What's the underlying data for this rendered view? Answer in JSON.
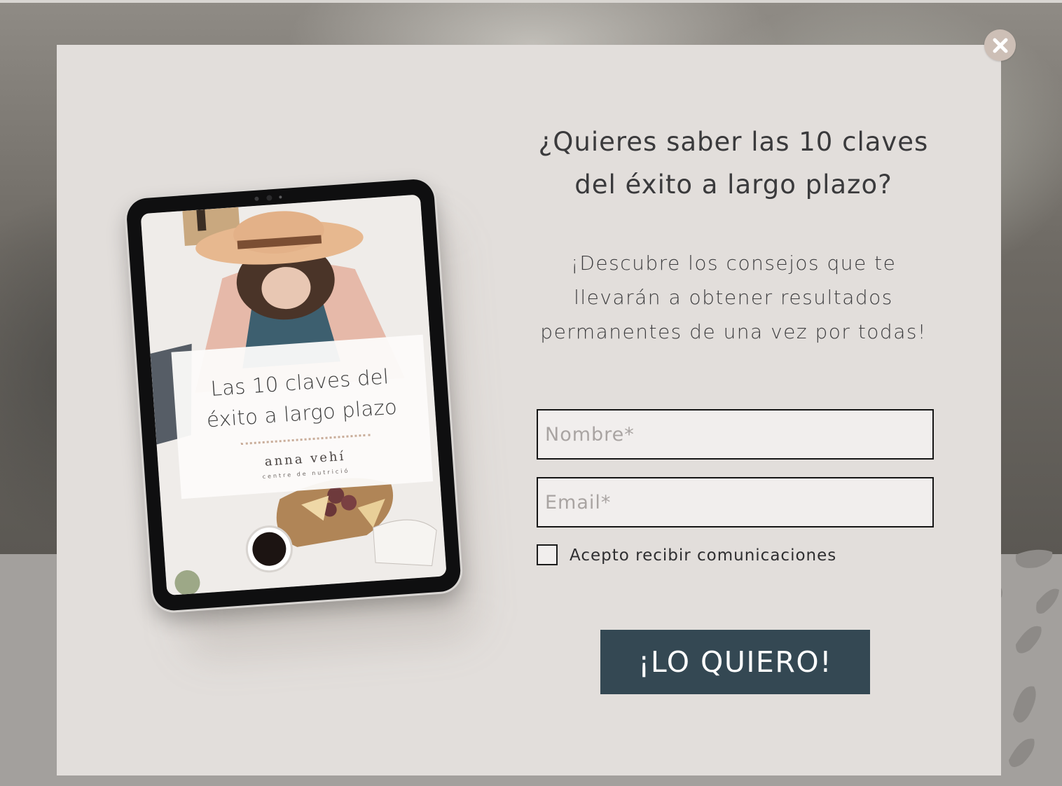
{
  "popup": {
    "headline": "¿Quieres saber las 10 claves\ndel éxito a largo plazo?",
    "subtext": "¡Descubre los consejos que te\nllevarán a obtener resultados\npermanentes de una vez por todas!",
    "name_placeholder": "Nombre*",
    "email_placeholder": "Email*",
    "consent_label": "Acepto recibir comunicaciones",
    "consent_checked": false,
    "submit_label": "¡LO QUIERO!",
    "close_icon": "close-icon"
  },
  "ebook": {
    "title": "Las 10 claves del\néxito a largo plazo",
    "brand": "anna vehí",
    "brand_subtitle": "centre de nutrició"
  },
  "colors": {
    "modal_bg": "#e2dedb",
    "button_bg": "#344853",
    "close_bg": "#cdbfb6",
    "text": "#3a3a3c"
  }
}
